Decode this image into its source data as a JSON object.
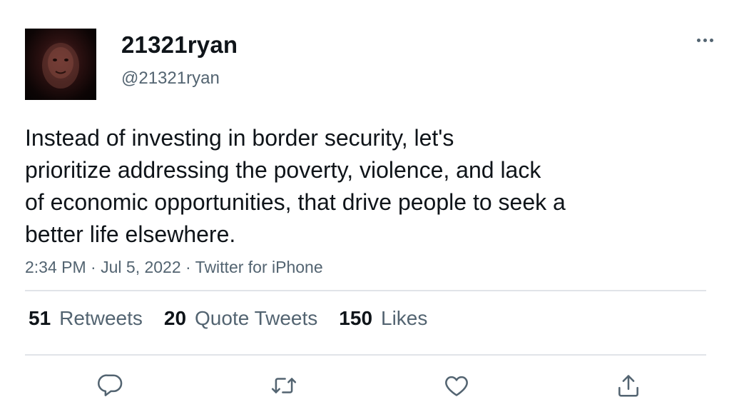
{
  "user": {
    "display_name": "21321ryan",
    "handle": "@21321ryan",
    "avatar_icon": "profile-photo"
  },
  "tweet": {
    "text": "Instead of investing in border security, let's\nprioritize addressing the poverty, violence, and lack\nof economic opportunities, that drive people to seek a\nbetter life elsewhere.",
    "time": "2:34 PM",
    "date": "Jul 5, 2022",
    "source": "Twitter for iPhone",
    "separator": " · "
  },
  "stats": {
    "retweets_count": "51",
    "retweets_label": "Retweets",
    "quotes_count": "20",
    "quotes_label": "Quote Tweets",
    "likes_count": "150",
    "likes_label": "Likes"
  },
  "actions": {
    "reply_icon": "reply-icon",
    "retweet_icon": "retweet-icon",
    "like_icon": "heart-icon",
    "share_icon": "share-icon"
  },
  "colors": {
    "text_primary": "#0f1419",
    "text_secondary": "#536471",
    "divider": "#e1e4e8",
    "background": "#ffffff"
  }
}
